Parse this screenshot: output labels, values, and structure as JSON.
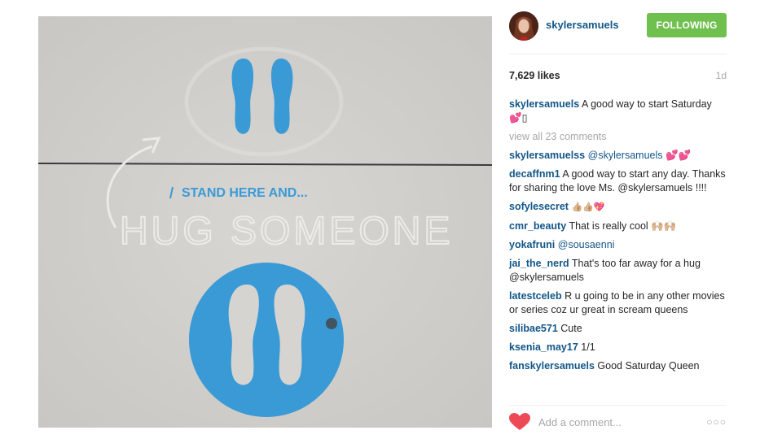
{
  "photo": {
    "stencil_text": "STAND HERE AND...",
    "chalk_text": "HUG SOMEONE",
    "stencil_color": "#3a9ad6"
  },
  "header": {
    "username": "skylersamuels",
    "follow_label": "FOLLOWING"
  },
  "post": {
    "likes": "7,629 likes",
    "age": "1d"
  },
  "caption": {
    "user": "skylersamuels",
    "text": "A good way to start Saturday 💕▯"
  },
  "view_all": "view all 23 comments",
  "comments": [
    {
      "user": "skylersamuelss",
      "text": "@skylersamuels 💕💕"
    },
    {
      "user": "decaffnm1",
      "text": "A good way to start any day. Thanks for sharing the love Ms. @skylersamuels !!!!"
    },
    {
      "user": "sofylesecret",
      "text": "👍🏼👍🏼💖"
    },
    {
      "user": "cmr_beauty",
      "text": "That is really cool 🙌🏼🙌🏼"
    },
    {
      "user": "yokafruni",
      "text": "@sousaenni"
    },
    {
      "user": "jai_the_nerd",
      "text": "That's too far away for a hug @skylersamuels"
    },
    {
      "user": "latestceleb",
      "text": "R u going to be in any other movies or series coz ur great in scream queens"
    },
    {
      "user": "silibae571",
      "text": "Cute"
    },
    {
      "user": "ksenia_may17",
      "text": "1/1"
    },
    {
      "user": "fanskylersamuels",
      "text": "Good Saturday Queen"
    }
  ],
  "footer": {
    "add_comment_placeholder": "Add a comment...",
    "more": "○○○"
  },
  "colors": {
    "username_blue": "#125688",
    "follow_green": "#70c050",
    "heart_red": "#ed4956",
    "muted": "#a5a7aa"
  }
}
